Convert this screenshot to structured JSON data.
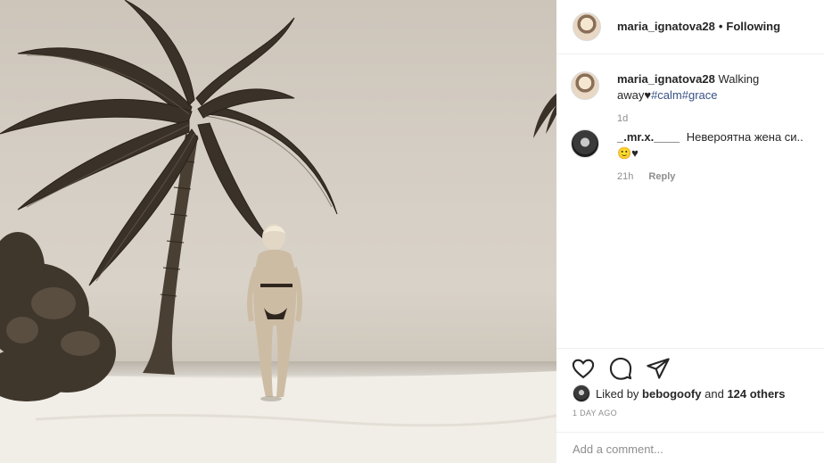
{
  "post": {
    "username": "maria_ignatova28",
    "separator": "•",
    "follow_status": "Following",
    "photo_description_icon": "photo-icon"
  },
  "caption": {
    "username": "maria_ignatova28",
    "text": "Walking away",
    "heart": "♥",
    "hashtags": [
      "#calm",
      "#grace"
    ],
    "time": "1d"
  },
  "comments": [
    {
      "username": "_.mr.x.____",
      "text": "Невероятна жена си..",
      "emoji": "🙂♥",
      "time": "21h",
      "reply_label": "Reply"
    }
  ],
  "actions": {
    "like_icon": "heart-icon",
    "comment_icon": "comment-icon",
    "share_icon": "share-icon"
  },
  "likes": {
    "prefix": "Liked by",
    "user": "bebogoofy",
    "suffix": "and",
    "others": "124 others"
  },
  "timestamp": "1 DAY AGO",
  "add_comment": {
    "placeholder": "Add a comment..."
  },
  "colors": {
    "text": "#262626",
    "muted": "#8e8e8e",
    "link": "#385185",
    "border": "#efefef"
  }
}
